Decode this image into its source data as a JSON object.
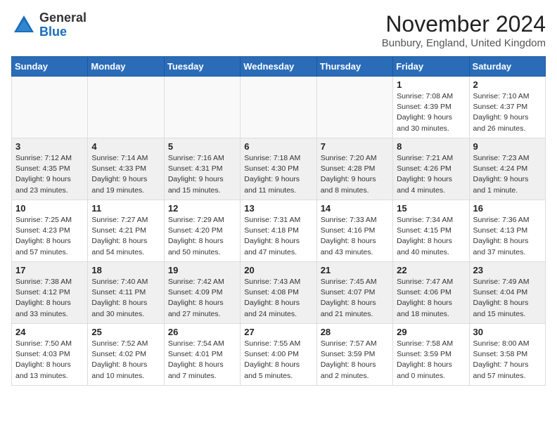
{
  "logo": {
    "general": "General",
    "blue": "Blue"
  },
  "title": "November 2024",
  "location": "Bunbury, England, United Kingdom",
  "days_of_week": [
    "Sunday",
    "Monday",
    "Tuesday",
    "Wednesday",
    "Thursday",
    "Friday",
    "Saturday"
  ],
  "weeks": [
    [
      {
        "day": "",
        "info": ""
      },
      {
        "day": "",
        "info": ""
      },
      {
        "day": "",
        "info": ""
      },
      {
        "day": "",
        "info": ""
      },
      {
        "day": "",
        "info": ""
      },
      {
        "day": "1",
        "info": "Sunrise: 7:08 AM\nSunset: 4:39 PM\nDaylight: 9 hours and 30 minutes."
      },
      {
        "day": "2",
        "info": "Sunrise: 7:10 AM\nSunset: 4:37 PM\nDaylight: 9 hours and 26 minutes."
      }
    ],
    [
      {
        "day": "3",
        "info": "Sunrise: 7:12 AM\nSunset: 4:35 PM\nDaylight: 9 hours and 23 minutes."
      },
      {
        "day": "4",
        "info": "Sunrise: 7:14 AM\nSunset: 4:33 PM\nDaylight: 9 hours and 19 minutes."
      },
      {
        "day": "5",
        "info": "Sunrise: 7:16 AM\nSunset: 4:31 PM\nDaylight: 9 hours and 15 minutes."
      },
      {
        "day": "6",
        "info": "Sunrise: 7:18 AM\nSunset: 4:30 PM\nDaylight: 9 hours and 11 minutes."
      },
      {
        "day": "7",
        "info": "Sunrise: 7:20 AM\nSunset: 4:28 PM\nDaylight: 9 hours and 8 minutes."
      },
      {
        "day": "8",
        "info": "Sunrise: 7:21 AM\nSunset: 4:26 PM\nDaylight: 9 hours and 4 minutes."
      },
      {
        "day": "9",
        "info": "Sunrise: 7:23 AM\nSunset: 4:24 PM\nDaylight: 9 hours and 1 minute."
      }
    ],
    [
      {
        "day": "10",
        "info": "Sunrise: 7:25 AM\nSunset: 4:23 PM\nDaylight: 8 hours and 57 minutes."
      },
      {
        "day": "11",
        "info": "Sunrise: 7:27 AM\nSunset: 4:21 PM\nDaylight: 8 hours and 54 minutes."
      },
      {
        "day": "12",
        "info": "Sunrise: 7:29 AM\nSunset: 4:20 PM\nDaylight: 8 hours and 50 minutes."
      },
      {
        "day": "13",
        "info": "Sunrise: 7:31 AM\nSunset: 4:18 PM\nDaylight: 8 hours and 47 minutes."
      },
      {
        "day": "14",
        "info": "Sunrise: 7:33 AM\nSunset: 4:16 PM\nDaylight: 8 hours and 43 minutes."
      },
      {
        "day": "15",
        "info": "Sunrise: 7:34 AM\nSunset: 4:15 PM\nDaylight: 8 hours and 40 minutes."
      },
      {
        "day": "16",
        "info": "Sunrise: 7:36 AM\nSunset: 4:13 PM\nDaylight: 8 hours and 37 minutes."
      }
    ],
    [
      {
        "day": "17",
        "info": "Sunrise: 7:38 AM\nSunset: 4:12 PM\nDaylight: 8 hours and 33 minutes."
      },
      {
        "day": "18",
        "info": "Sunrise: 7:40 AM\nSunset: 4:11 PM\nDaylight: 8 hours and 30 minutes."
      },
      {
        "day": "19",
        "info": "Sunrise: 7:42 AM\nSunset: 4:09 PM\nDaylight: 8 hours and 27 minutes."
      },
      {
        "day": "20",
        "info": "Sunrise: 7:43 AM\nSunset: 4:08 PM\nDaylight: 8 hours and 24 minutes."
      },
      {
        "day": "21",
        "info": "Sunrise: 7:45 AM\nSunset: 4:07 PM\nDaylight: 8 hours and 21 minutes."
      },
      {
        "day": "22",
        "info": "Sunrise: 7:47 AM\nSunset: 4:06 PM\nDaylight: 8 hours and 18 minutes."
      },
      {
        "day": "23",
        "info": "Sunrise: 7:49 AM\nSunset: 4:04 PM\nDaylight: 8 hours and 15 minutes."
      }
    ],
    [
      {
        "day": "24",
        "info": "Sunrise: 7:50 AM\nSunset: 4:03 PM\nDaylight: 8 hours and 13 minutes."
      },
      {
        "day": "25",
        "info": "Sunrise: 7:52 AM\nSunset: 4:02 PM\nDaylight: 8 hours and 10 minutes."
      },
      {
        "day": "26",
        "info": "Sunrise: 7:54 AM\nSunset: 4:01 PM\nDaylight: 8 hours and 7 minutes."
      },
      {
        "day": "27",
        "info": "Sunrise: 7:55 AM\nSunset: 4:00 PM\nDaylight: 8 hours and 5 minutes."
      },
      {
        "day": "28",
        "info": "Sunrise: 7:57 AM\nSunset: 3:59 PM\nDaylight: 8 hours and 2 minutes."
      },
      {
        "day": "29",
        "info": "Sunrise: 7:58 AM\nSunset: 3:59 PM\nDaylight: 8 hours and 0 minutes."
      },
      {
        "day": "30",
        "info": "Sunrise: 8:00 AM\nSunset: 3:58 PM\nDaylight: 7 hours and 57 minutes."
      }
    ]
  ]
}
